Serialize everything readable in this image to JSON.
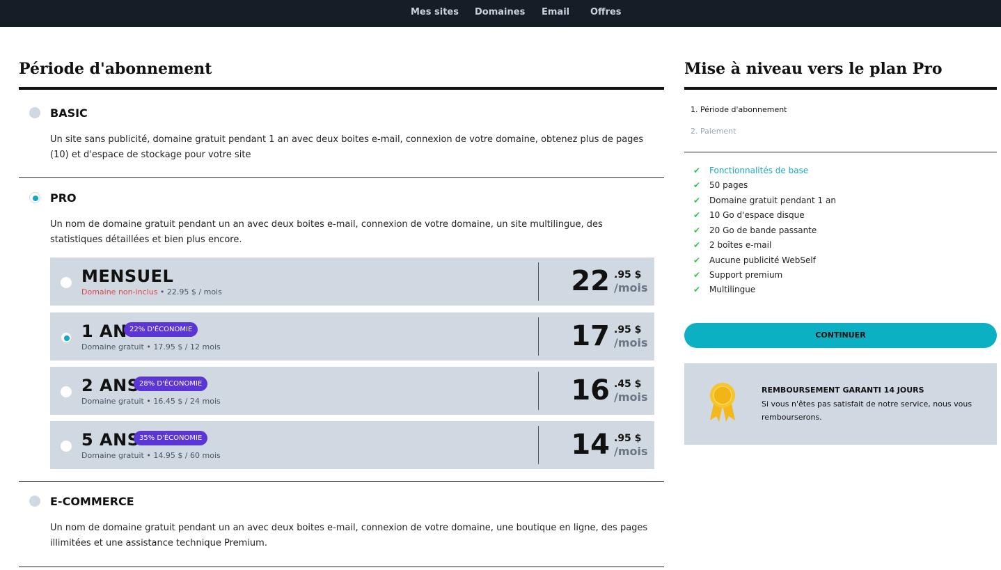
{
  "topnav": {
    "items": [
      "Mes sites",
      "Domaines",
      "Email",
      "Offres"
    ]
  },
  "left": {
    "title": "Période d'abonnement",
    "plans": [
      {
        "name": "BASIC",
        "description": "Un site sans publicité, domaine gratuit pendant 1 an avec deux boites e-mail, connexion de votre domaine, obtenez plus de pages (10) et d'espace de stockage pour votre site",
        "selected": false
      },
      {
        "name": "PRO",
        "description": "Un nom de domaine gratuit pendant un an avec deux boites e-mail, connexion de votre domaine, un site multilingue, des statistiques détaillées et bien plus encore.",
        "selected": true
      },
      {
        "name": "E-COMMERCE",
        "description": "Un nom de domaine gratuit pendant un an avec deux boites e-mail, connexion de votre domaine, une boutique en ligne, des pages illimitées et une assistance technique Premium.",
        "selected": false
      }
    ],
    "periods": [
      {
        "name": "MENSUEL",
        "badge": "",
        "sub_highlight": "Domaine non-inclus",
        "sub_text": " • 22.95 $ / mois",
        "price_int": "22",
        "price_dec": ".95 $",
        "price_unit": "/mois",
        "selected": false
      },
      {
        "name": "1 AN",
        "badge": "22% D'ÉCONOMIE",
        "sub_highlight": "",
        "sub_text": "Domaine gratuit • 17.95 $ / 12 mois",
        "price_int": "17",
        "price_dec": ".95 $",
        "price_unit": "/mois",
        "selected": true
      },
      {
        "name": "2 ANS",
        "badge": "28% D'ÉCONOMIE",
        "sub_highlight": "",
        "sub_text": "Domaine gratuit • 16.45 $ / 24 mois",
        "price_int": "16",
        "price_dec": ".45 $",
        "price_unit": "/mois",
        "selected": false
      },
      {
        "name": "5 ANS",
        "badge": "35% D'ÉCONOMIE",
        "sub_highlight": "",
        "sub_text": "Domaine gratuit • 14.95 $ / 60 mois",
        "price_int": "14",
        "price_dec": ".95 $",
        "price_unit": "/mois",
        "selected": false
      }
    ]
  },
  "right": {
    "title": "Mise à niveau vers le plan Pro",
    "steps": [
      "1. Période d'abonnement",
      "2. Paiement"
    ],
    "features": [
      "Fonctionnalités de base",
      "50 pages",
      "Domaine gratuit pendant 1 an",
      "10 Go d'espace disque",
      "20 Go de bande passante",
      "2 boîtes e-mail",
      "Aucune publicité WebSelf",
      "Support premium",
      "Multilingue"
    ],
    "continue_label": "CONTINUER",
    "guarantee": {
      "title": "REMBOURSEMENT GARANTI 14 JOURS",
      "text": "Si vous n'êtes pas satisfait de notre service, nous vous rembourserons.",
      "icon": "award-ribbon-icon"
    }
  },
  "colors": {
    "nav_bg": "#161d27",
    "accent": "#0bb0c2",
    "badge": "#5b35d5",
    "card_bg": "#d0d8e1",
    "check": "#3fbf5a",
    "warning": "#e0464a"
  }
}
